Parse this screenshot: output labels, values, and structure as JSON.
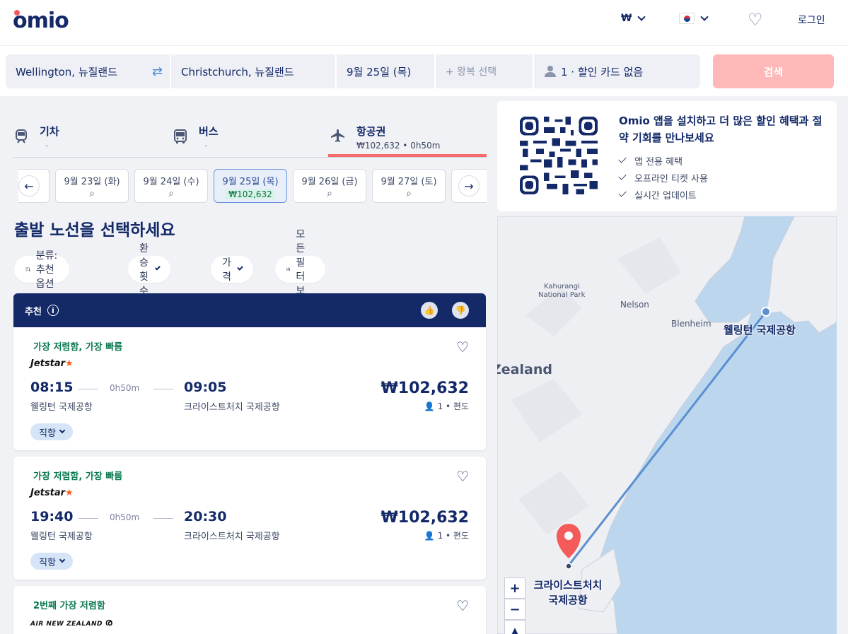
{
  "header": {
    "logo": "omio",
    "currency": "₩",
    "login": "로그인",
    "icons": {
      "currency_chevron": "chevron-down-icon",
      "flag": "korea-flag-icon",
      "favorites": "heart-icon"
    }
  },
  "search": {
    "from": "Wellington, 뉴질랜드",
    "to": "Christchurch, 뉴질랜드",
    "date": "9월 25일 (목)",
    "return_placeholder": "+ 왕복 선택",
    "passengers": "1 · 할인 카드 없음",
    "button": "검색"
  },
  "modes": [
    {
      "label": "기차",
      "sub": "-",
      "icon": "train-icon"
    },
    {
      "label": "버스",
      "sub": "-",
      "icon": "bus-icon"
    },
    {
      "label": "항공권",
      "sub": "₩102,632 • 0h50m",
      "icon": "plane-icon",
      "active": true
    }
  ],
  "dates": [
    {
      "label": "9월 23일 (화)"
    },
    {
      "label": "9월 24일 (수)"
    },
    {
      "label": "9월 25일 (목)",
      "price": "₩102,632",
      "active": true
    },
    {
      "label": "9월 26일 (금)"
    },
    {
      "label": "9월 27일 (토)"
    }
  ],
  "page_title": "출발 노선을 선택하세요",
  "filters": {
    "sort": "분류: 추천 옵션",
    "transfers": "환승횟수",
    "price": "가격",
    "all": "모든 필터 보기"
  },
  "recommended_label": "추천",
  "results": [
    {
      "tag": "가장 저렴함, 가장 빠름",
      "airline": "Jetstar",
      "dep": "08:15",
      "arr": "09:05",
      "duration": "0h50m",
      "from": "웰링턴 국제공항",
      "to": "크라이스트처치 국제공항",
      "price": "₩102,632",
      "pax": "1  •  편도",
      "stops": "직항"
    },
    {
      "tag": "가장 저렴함, 가장 빠름",
      "airline": "Jetstar",
      "dep": "19:40",
      "arr": "20:30",
      "duration": "0h50m",
      "from": "웰링턴 국제공항",
      "to": "크라이스트처치 국제공항",
      "price": "₩102,632",
      "pax": "1  •  편도",
      "stops": "직항"
    },
    {
      "tag": "2번째 가장 저렴함",
      "airline": "AIR NEW ZEALAND"
    }
  ],
  "promo": {
    "title": "Omio 앱을 설치하고 더 많은 할인 혜택과 절약 기회를 만나보세요",
    "items": [
      "앱 전용 혜택",
      "오프라인 티켓 사용",
      "실시간 업데이트"
    ]
  },
  "map": {
    "labels": [
      "Kahurangi",
      "National Park",
      "Nelson",
      "Blenheim",
      "Zealand"
    ],
    "origin": "웰링턴 국제공항",
    "destination_line1": "크라이스트처치",
    "destination_line2": "국제공항",
    "zoom_in": "+",
    "zoom_out": "−"
  },
  "colors": {
    "brand": "#132968",
    "accent": "#f56a6a",
    "search_button": "#ffb8b8",
    "tag": "#0a7a4e",
    "route": "#5b8fd0"
  }
}
